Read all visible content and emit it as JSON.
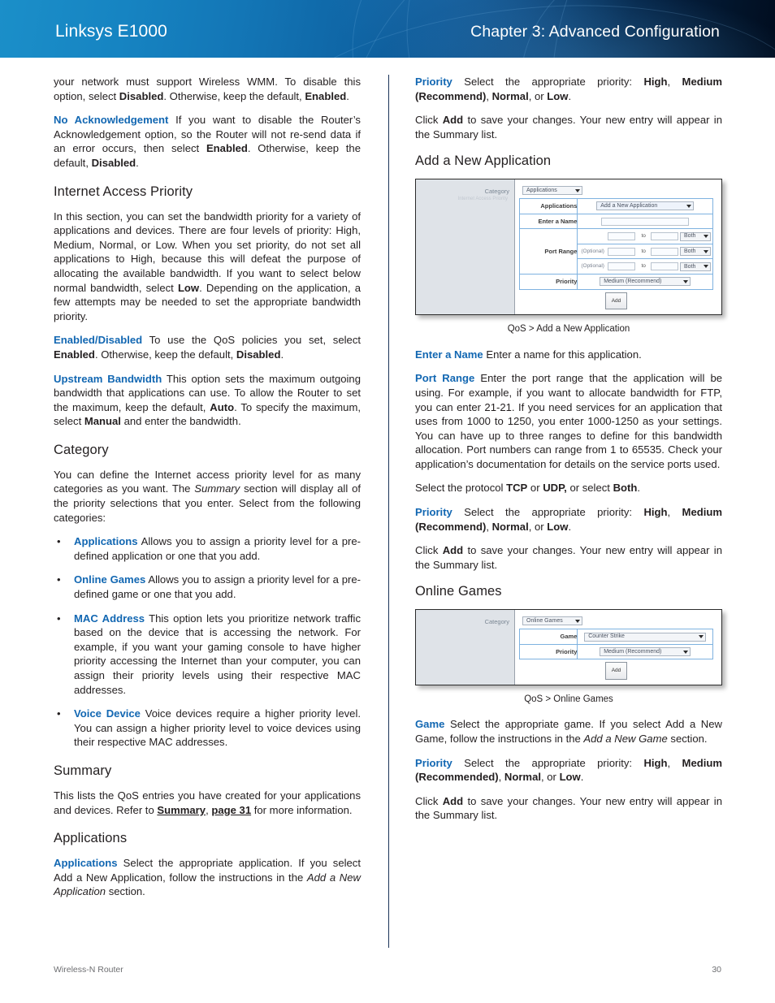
{
  "header": {
    "product": "Linksys E1000",
    "chapter": "Chapter 3: Advanced Configuration"
  },
  "footer": {
    "left": "Wireless-N Router",
    "page": "30"
  },
  "left_column": {
    "p_wmm_1": "your network must support Wireless WMM. To disable",
    "p_wmm_2": "this option, select ",
    "p_wmm_disabled": "Disabled",
    "p_wmm_3": ". Otherwise, keep the default, ",
    "p_wmm_enabled": "Enabled",
    "p_wmm_4": ".",
    "no_ack_term": "No Acknowledgement",
    "no_ack_body_1": " If you want to disable the Router’s Acknowledgement option, so the Router will not re-send data if an error occurs, then select ",
    "no_ack_enabled": "Enabled",
    "no_ack_body_2": ". Otherwise, keep the default, ",
    "no_ack_disabled": "Disabled",
    "no_ack_body_3": ".",
    "h_internet_access_priority": "Internet Access Priority",
    "iap_body_1": "In this section, you can set the bandwidth priority for a variety of applications and devices. There are four levels of priority: High, Medium, Normal, or Low. When you set priority, do not set all applications to High, because this will defeat the purpose of allocating the available bandwidth. If you want to select below normal bandwidth, select ",
    "iap_low": "Low",
    "iap_body_2": ". Depending on the application, a few attempts may be needed to set the appropriate bandwidth priority.",
    "enabled_disabled_term": "Enabled/Disabled",
    "enabled_disabled_body_1": "  To use the QoS policies you set, select ",
    "enabled_disabled_enabled": "Enabled",
    "enabled_disabled_body_2": ". Otherwise, keep the default, ",
    "enabled_disabled_disabled": "Disabled",
    "enabled_disabled_body_3": ".",
    "upstream_term": "Upstream Bandwidth",
    "upstream_body_1": " This option sets the maximum outgoing bandwidth that applications can use. To allow the Router to set the maximum, keep the default, ",
    "upstream_auto": "Auto",
    "upstream_body_2": ". To specify the maximum, select ",
    "upstream_manual": "Manual",
    "upstream_body_3": " and enter the bandwidth.",
    "h_category": "Category",
    "category_body_1": "You can define the Internet access priority level for as many categories as you want. The ",
    "category_summary_italic": "Summary",
    "category_body_2": " section will display all of the priority selections that you enter. Select from the following categories:",
    "bullets": [
      {
        "term": "Applications",
        "body": "  Allows you to assign a priority level for a pre-defined application or one that you add."
      },
      {
        "term": "Online Games",
        "body": "  Allows you to assign a priority level for a pre-defined game or one that you add."
      },
      {
        "term": "MAC Address",
        "body": "  This option lets you prioritize network traffic based on the device that is accessing the network. For example, if you want your gaming console to have higher priority accessing the Internet than your computer, you can assign their priority levels using their respective MAC addresses."
      },
      {
        "term": "Voice Device",
        "body": "  Voice devices require a higher priority level. You can assign a higher priority level to voice devices using their respective MAC addresses."
      }
    ],
    "h_summary": "Summary",
    "summary_body_1": "This lists the QoS entries you have created for your applications and devices. Refer to ",
    "summary_link_1": "Summary",
    "summary_body_2": ", ",
    "summary_link_2": "page 31",
    "summary_body_3": " for more information.",
    "h_applications": "Applications",
    "applications_term": "Applications",
    "applications_body_1": " Select the appropriate application. If you select Add a New Application, follow the instructions in the ",
    "applications_italic": "Add a New Application",
    "applications_body_2": " section."
  },
  "right_column": {
    "priority_term_1": "Priority",
    "priority_body_1a": " Select the appropriate priority: ",
    "priority_high_1": "High",
    "priority_sep_1": ", ",
    "priority_medium_1": "Medium (Recommend)",
    "priority_sep_2": ", ",
    "priority_normal_1": "Normal",
    "priority_sep_3": ", or ",
    "priority_low_1": "Low",
    "priority_end_1": ".",
    "click_add_1a": "Click ",
    "click_add_1b": "Add",
    "click_add_1c": " to save your changes. Your new entry will appear in the Summary list.",
    "h_add_new_application": "Add a New Application",
    "caption_1": "QoS > Add a New Application",
    "enter_name_term": "Enter a Name",
    "enter_name_body": "  Enter a name for this application.",
    "port_range_term": "Port Range",
    "port_range_body": "  Enter the port range that the application will be using. For example, if you want to allocate bandwidth for FTP, you can enter 21-21. If you need services for an application that uses from 1000 to 1250, you enter 1000-1250 as your settings. You can have up to three ranges to define for this bandwidth allocation. Port numbers can range from 1 to 65535. Check your application’s documentation for details on the service ports used.",
    "protocol_body_1": "Select the protocol ",
    "protocol_tcp": "TCP",
    "protocol_or": " or ",
    "protocol_udp": "UDP,",
    "protocol_body_2": " or select ",
    "protocol_both": "Both",
    "protocol_end": ".",
    "priority_term_2": "Priority",
    "priority_body_2a": " Select the appropriate priority: ",
    "priority_high_2": "High",
    "priority_medium_2": "Medium (Recommend)",
    "priority_normal_2": "Normal",
    "priority_low_2": "Low",
    "click_add_2a": "Click ",
    "click_add_2b": "Add",
    "click_add_2c": " to save your changes. Your new entry will appear in the Summary list.",
    "h_online_games": "Online Games",
    "caption_2": "QoS > Online Games",
    "game_term": "Game",
    "game_body_1": "  Select the appropriate game. If you select Add a New Game, follow the instructions in the ",
    "game_italic": "Add a New Game",
    "game_body_2": " section.",
    "priority_term_3": "Priority",
    "priority_body_3a": " Select the appropriate priority: ",
    "priority_high_3": "High",
    "priority_medium_3": "Medium (Recommended)",
    "priority_normal_3": "Normal",
    "priority_low_3": "Low",
    "click_add_3a": "Click ",
    "click_add_3b": "Add",
    "click_add_3c": " to save your changes. Your new entry will appear in the Summary list."
  },
  "figure_add_application": {
    "category_label": "Category",
    "category_sub": "Internet Access Priority",
    "category_select": "Applications",
    "rows": {
      "applications_label": "Applications",
      "applications_select": "Add a New Application",
      "enter_name_label": "Enter a Name",
      "port_range_label": "Port Range",
      "optional_label": "(Optional)",
      "to_label": "to",
      "both_label": "Both",
      "priority_label": "Priority",
      "priority_select": "Medium (Recommend)"
    },
    "add_button": "Add"
  },
  "figure_online_games": {
    "category_label": "Category",
    "category_select": "Online Games",
    "rows": {
      "game_label": "Game",
      "game_select": "Counter Strike",
      "priority_label": "Priority",
      "priority_select": "Medium (Recommend)"
    },
    "add_button": "Add"
  },
  "colors": {
    "term_blue": "#1267b2",
    "banner_light": "#1b8fc9",
    "banner_dark": "#010d1f",
    "divider": "#1b3358"
  }
}
